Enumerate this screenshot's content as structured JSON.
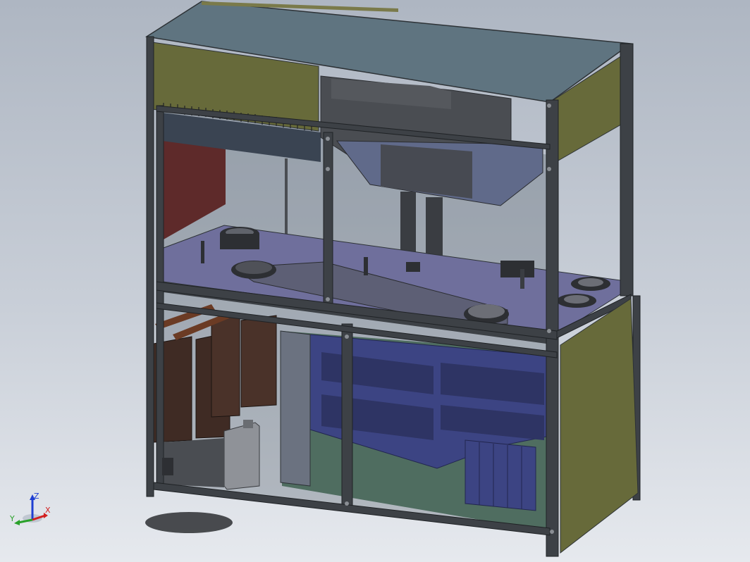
{
  "viewport": {
    "background_top": "#aeb6c2",
    "background_bottom": "#e6e9ee"
  },
  "model": {
    "frame_color": "#3d4146",
    "top_cover_color": "#5f7480",
    "side_panel_color": "#676a3a",
    "deck_color": "#6f6f9c",
    "lower_block_color": "#3c4483",
    "cartridge_color": "#3f2b24",
    "rear_panel_color": "#4f6d60",
    "red_panel_color": "#5e2a2a"
  },
  "triad": {
    "x_label": "X",
    "y_label": "Y",
    "z_label": "Z",
    "x_color": "#d21f1f",
    "y_color": "#2aa12a",
    "z_color": "#1f3fd2"
  }
}
